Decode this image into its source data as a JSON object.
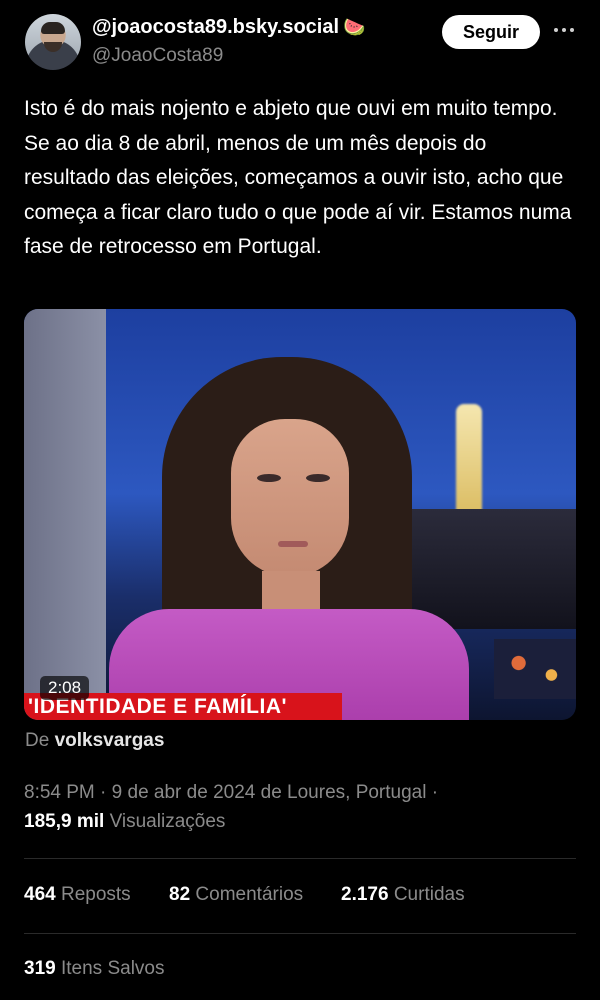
{
  "author": {
    "display_name": "@joaocosta89.bsky.social",
    "emoji": "🍉",
    "handle": "@JoaoCosta89",
    "follow_label": "Seguir"
  },
  "post": {
    "text": "Isto é do mais nojento e abjeto que ouvi em muito tempo. Se ao dia 8 de abril, menos de um mês depois do resultado das eleições, começamos a ouvir isto, acho que começa a ficar claro tudo o que pode aí vir. Estamos numa fase de retrocesso em Portugal."
  },
  "video": {
    "duration": "2:08",
    "banner": "'IDENTIDADE E FAMÍLIA'"
  },
  "source": {
    "prefix": "De",
    "name": "volksvargas"
  },
  "meta": {
    "time": "8:54 PM",
    "date": "9 de abr de 2024",
    "location": "de Loures, Portugal",
    "views_count": "185,9 mil",
    "views_label": "Visualizações"
  },
  "stats": {
    "reposts_count": "464",
    "reposts_label": "Reposts",
    "comments_count": "82",
    "comments_label": "Comentários",
    "likes_count": "2.176",
    "likes_label": "Curtidas",
    "saved_count": "319",
    "saved_label": "Itens Salvos"
  },
  "icons": [
    "avatar",
    "more-icon"
  ]
}
